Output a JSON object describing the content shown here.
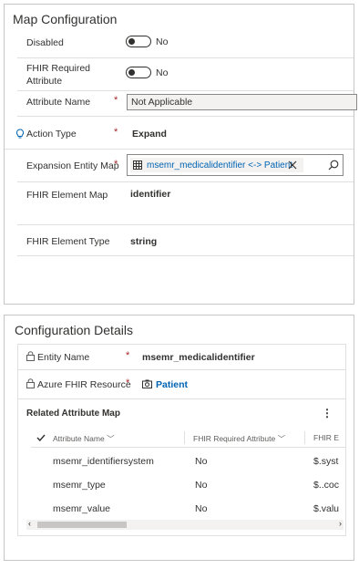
{
  "map_config": {
    "title": "Map Configuration",
    "disabled": {
      "label": "Disabled",
      "value": "No"
    },
    "fhir_required": {
      "label_line1": "FHIR Required",
      "label_line2": "Attribute",
      "value": "No"
    },
    "attribute_name": {
      "label": "Attribute Name",
      "required_mark": "*",
      "value": "Not Applicable"
    },
    "action_type": {
      "label": "Action Type",
      "required_mark": "*",
      "value": "Expand"
    },
    "expansion_map": {
      "label": "Expansion Entity Map",
      "required_mark": "*",
      "value": "msemr_medicalidentifier <-> Patient"
    },
    "fhir_element_map": {
      "label": "FHIR Element Map",
      "value": "identifier"
    },
    "fhir_element_type": {
      "label": "FHIR Element Type",
      "value": "string"
    }
  },
  "config_details": {
    "title": "Configuration Details",
    "entity_name": {
      "label": "Entity Name",
      "required_mark": "*",
      "value": "msemr_medicalidentifier"
    },
    "azure_resource": {
      "label": "Azure FHIR Resource",
      "required_mark": "*",
      "value": "Patient"
    },
    "related_map": {
      "title": "Related Attribute Map",
      "more": "⋮",
      "columns": [
        "Attribute Name",
        "FHIR Required Attribute",
        "FHIR E"
      ],
      "rows": [
        {
          "name": "msemr_identifiersystem",
          "required": "No",
          "fhir": "$.syst"
        },
        {
          "name": "msemr_type",
          "required": "No",
          "fhir": "$..coc"
        },
        {
          "name": "msemr_value",
          "required": "No",
          "fhir": "$.valu"
        }
      ]
    }
  }
}
